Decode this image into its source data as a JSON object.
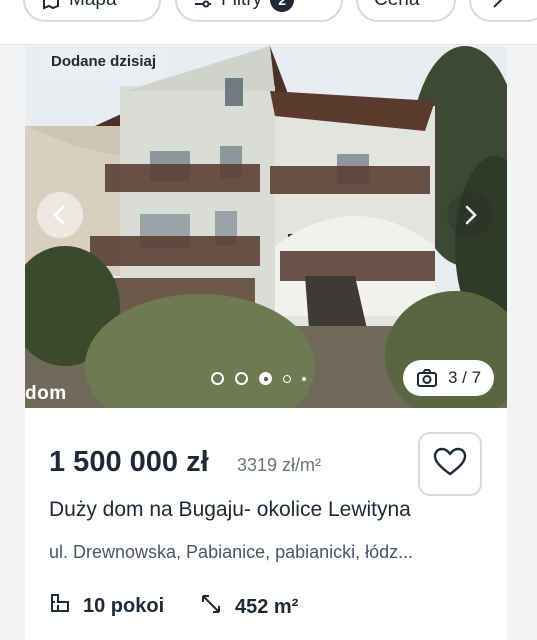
{
  "filters": {
    "map_label": "Mapa",
    "filters_label": "Filtry",
    "filters_count": "2",
    "price_label": "Cena"
  },
  "listing": {
    "badge": "Dodane dzisiaj",
    "photo_counter": "3 / 7",
    "watermark": "dom",
    "price": "1 500 000 zł",
    "price_per_m2": "3319 zł/m²",
    "title": "Duży dom na Bugaju- okolice Lewityna",
    "address": "ul. Drewnowska, Pabianice, pabianicki, łódz...",
    "rooms": "10 pokoi",
    "area": "452 m²",
    "current_photo": 3,
    "total_photos": 7
  },
  "icons": {
    "map": "map-icon",
    "filters": "sliders-icon",
    "more": "chevron-right-icon",
    "prev": "chevron-left-icon",
    "next": "chevron-right-icon",
    "camera": "camera-icon",
    "favorite": "heart-icon",
    "rooms": "floorplan-icon",
    "area": "resize-arrows-icon"
  }
}
